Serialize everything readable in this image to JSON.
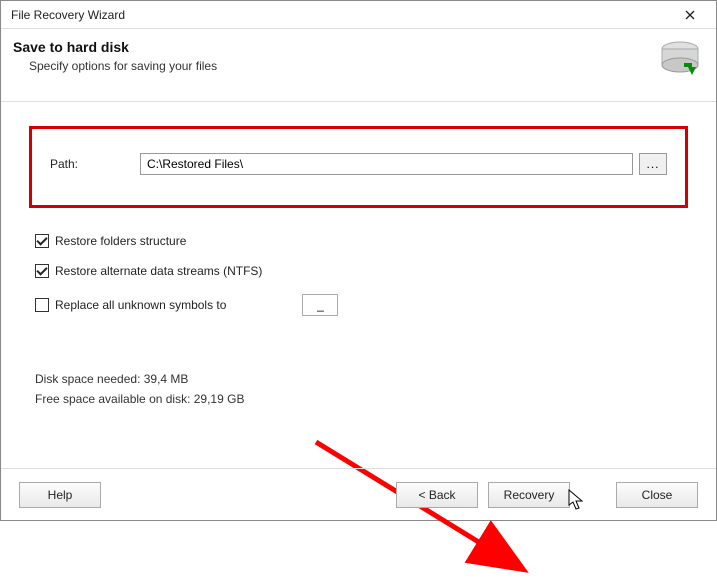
{
  "titlebar": {
    "title": "File Recovery Wizard"
  },
  "header": {
    "title": "Save to hard disk",
    "subtitle": "Specify options for saving your files"
  },
  "path": {
    "label": "Path:",
    "value": "C:\\Restored Files\\",
    "browse_label": "..."
  },
  "options": {
    "restore_folders": {
      "label": "Restore folders structure",
      "checked": true
    },
    "restore_ads": {
      "label": "Restore alternate data streams (NTFS)",
      "checked": true
    },
    "replace_symbols": {
      "label": "Replace all unknown symbols to",
      "checked": false,
      "value": "_"
    }
  },
  "stats": {
    "disk_space": "Disk space needed: 39,4 MB",
    "free_space": "Free space available on disk: 29,19 GB"
  },
  "footer": {
    "help": "Help",
    "back": "< Back",
    "recovery": "Recovery",
    "close": "Close"
  }
}
